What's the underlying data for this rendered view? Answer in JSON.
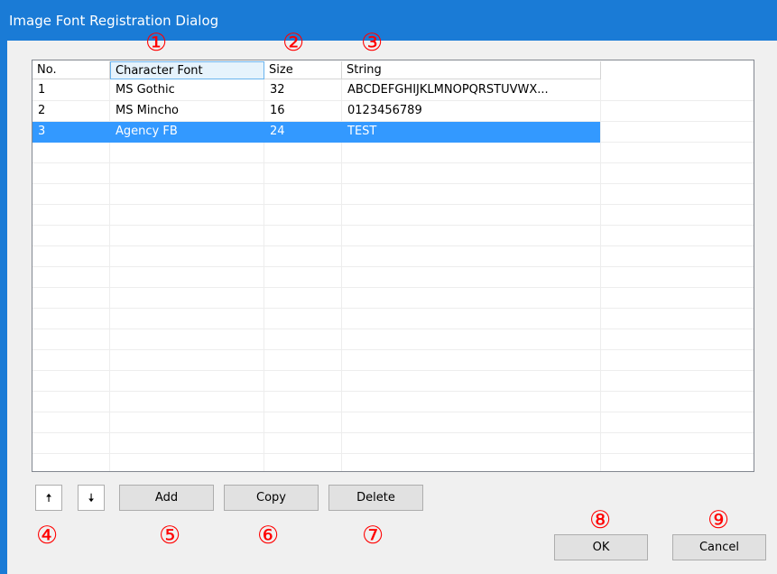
{
  "window": {
    "title": "Image Font Registration Dialog"
  },
  "table": {
    "columns": [
      "No.",
      "Character Font",
      "Size",
      "String"
    ],
    "rows": [
      {
        "no": "1",
        "font": "MS Gothic",
        "size": "32",
        "string": "ABCDEFGHIJKLMNOPQRSTUVWX..."
      },
      {
        "no": "2",
        "font": "MS Mincho",
        "size": "16",
        "string": "0123456789"
      },
      {
        "no": "3",
        "font": "Agency FB",
        "size": "24",
        "string": "TEST"
      }
    ]
  },
  "buttons": {
    "up": "🠅",
    "down": "🠇",
    "add": "Add",
    "copy": "Copy",
    "delete": "Delete",
    "ok": "OK",
    "cancel": "Cancel"
  },
  "callouts": [
    "①",
    "②",
    "③",
    "④",
    "⑤",
    "⑥",
    "⑦",
    "⑧",
    "⑨"
  ],
  "colors": {
    "titlebar": "#1a7bd6",
    "selection": "#3399ff",
    "callout": "#ff0000"
  }
}
